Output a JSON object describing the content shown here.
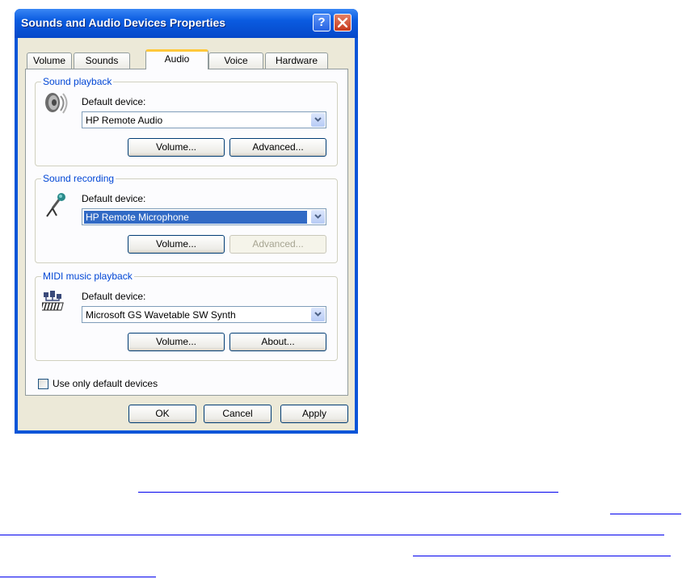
{
  "window": {
    "title": "Sounds and Audio Devices Properties",
    "help_glyph": "?",
    "close_glyph": "✕"
  },
  "tabs": [
    {
      "label": "Volume",
      "active": false
    },
    {
      "label": "Sounds",
      "active": false
    },
    {
      "label": "Audio",
      "active": true
    },
    {
      "label": "Voice",
      "active": false
    },
    {
      "label": "Hardware",
      "active": false
    }
  ],
  "sound_playback": {
    "title": "Sound playback",
    "icon": "speaker-icon",
    "device_label": "Default device:",
    "device_value": "HP Remote Audio",
    "volume_button": "Volume...",
    "advanced_button": "Advanced..."
  },
  "sound_recording": {
    "title": "Sound recording",
    "icon": "microphone-icon",
    "device_label": "Default device:",
    "device_value": "HP Remote Microphone",
    "volume_button": "Volume...",
    "advanced_button": "Advanced..."
  },
  "midi_playback": {
    "title": "MIDI music playback",
    "icon": "midi-keyboard-icon",
    "device_label": "Default device:",
    "device_value": "Microsoft GS Wavetable SW Synth",
    "volume_button": "Volume...",
    "about_button": "About..."
  },
  "use_default_checkbox": {
    "label": "Use only default devices",
    "checked": false
  },
  "footer": {
    "ok": "OK",
    "cancel": "Cancel",
    "apply": "Apply"
  },
  "colors": {
    "title_bar": "#0a5be0",
    "group_label": "#0046d5",
    "selection": "#316ac5",
    "link": "#0000ee"
  }
}
